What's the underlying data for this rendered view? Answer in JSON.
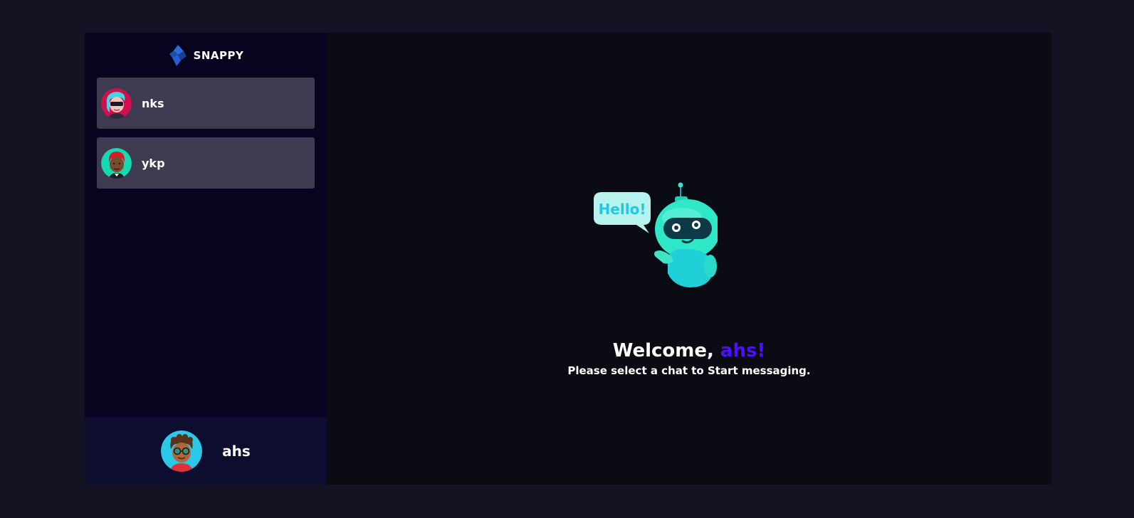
{
  "brand": {
    "name": "SNAPPY"
  },
  "contacts": [
    {
      "name": "nks",
      "avatar": "avatar-pink-hair-sunglasses"
    },
    {
      "name": "ykp",
      "avatar": "avatar-red-hair-green-bg"
    }
  ],
  "current_user": {
    "name": "ahs",
    "avatar": "avatar-curly-hair-glasses"
  },
  "welcome": {
    "greeting": "Welcome, ",
    "username": "ahs!",
    "subtitle": "Please select a chat to Start messaging.",
    "bubble_text": "Hello!"
  },
  "colors": {
    "page_bg": "#131324",
    "sidebar_bg": "#080420",
    "contact_bg": "#3e3b50",
    "current_user_bg": "#0d0d30",
    "main_bg": "#0a0b13",
    "accent": "#4e0eff",
    "robot_teal": "#2ee8c8"
  }
}
